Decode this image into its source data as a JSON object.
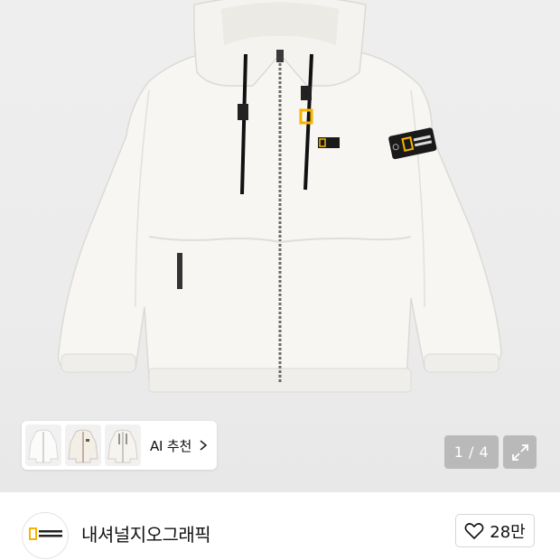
{
  "gallery": {
    "image_alt_icon": "hoodie-fleece-jacket-photo",
    "ai_recommend_label": "AI 추천",
    "page_indicator": "1 / 4",
    "current_page": 1,
    "total_pages": 4
  },
  "brand": {
    "name": "내셔널지오그래픽",
    "logo_text": "NATIONAL GEOGRAPHIC",
    "accent_color": "#F5B400"
  },
  "like": {
    "count": "28만"
  },
  "colors": {
    "image_bg": "#ECECEC",
    "overlay_bg": "#A0A0A0"
  }
}
